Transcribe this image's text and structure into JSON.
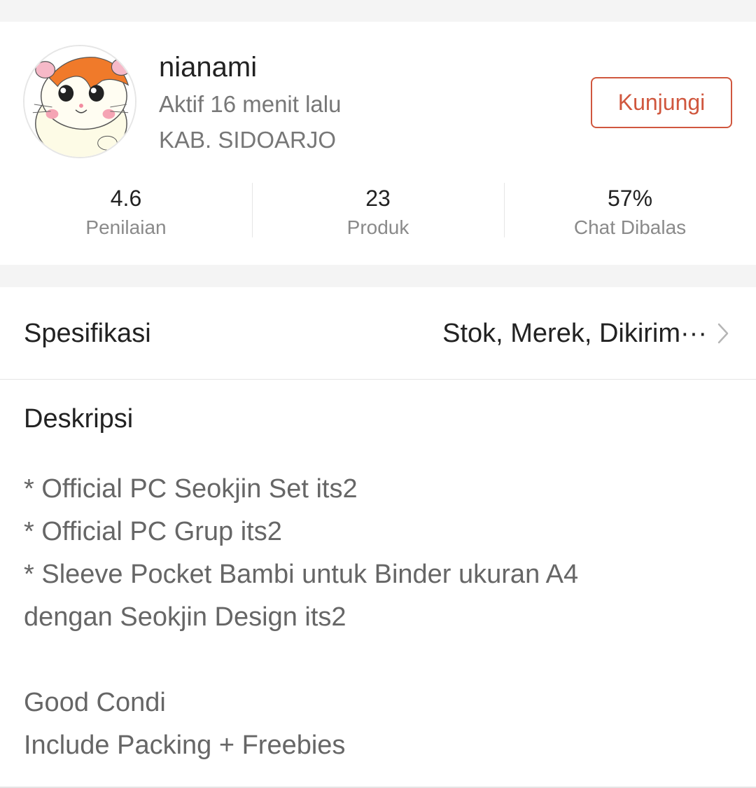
{
  "shop": {
    "name": "nianami",
    "active_status": "Aktif 16 menit lalu",
    "location": "KAB. SIDOARJO",
    "visit_label": "Kunjungi",
    "avatar_icon": "hamster-avatar-icon",
    "accent_color": "#d0573e"
  },
  "stats": [
    {
      "value": "4.6",
      "label": "Penilaian"
    },
    {
      "value": "23",
      "label": "Produk"
    },
    {
      "value": "57%",
      "label": "Chat Dibalas"
    }
  ],
  "specification": {
    "label": "Spesifikasi",
    "value": "Stok, Merek, Dikirim···",
    "icon": "chevron-right-icon"
  },
  "description": {
    "title": "Deskripsi",
    "lines": [
      "* Official PC Seokjin Set its2",
      "* Official PC Grup its2",
      "* Sleeve Pocket Bambi untuk Binder ukuran A4",
      "dengan Seokjin Design its2",
      "",
      "Good Condi",
      "Include Packing + Freebies"
    ]
  }
}
